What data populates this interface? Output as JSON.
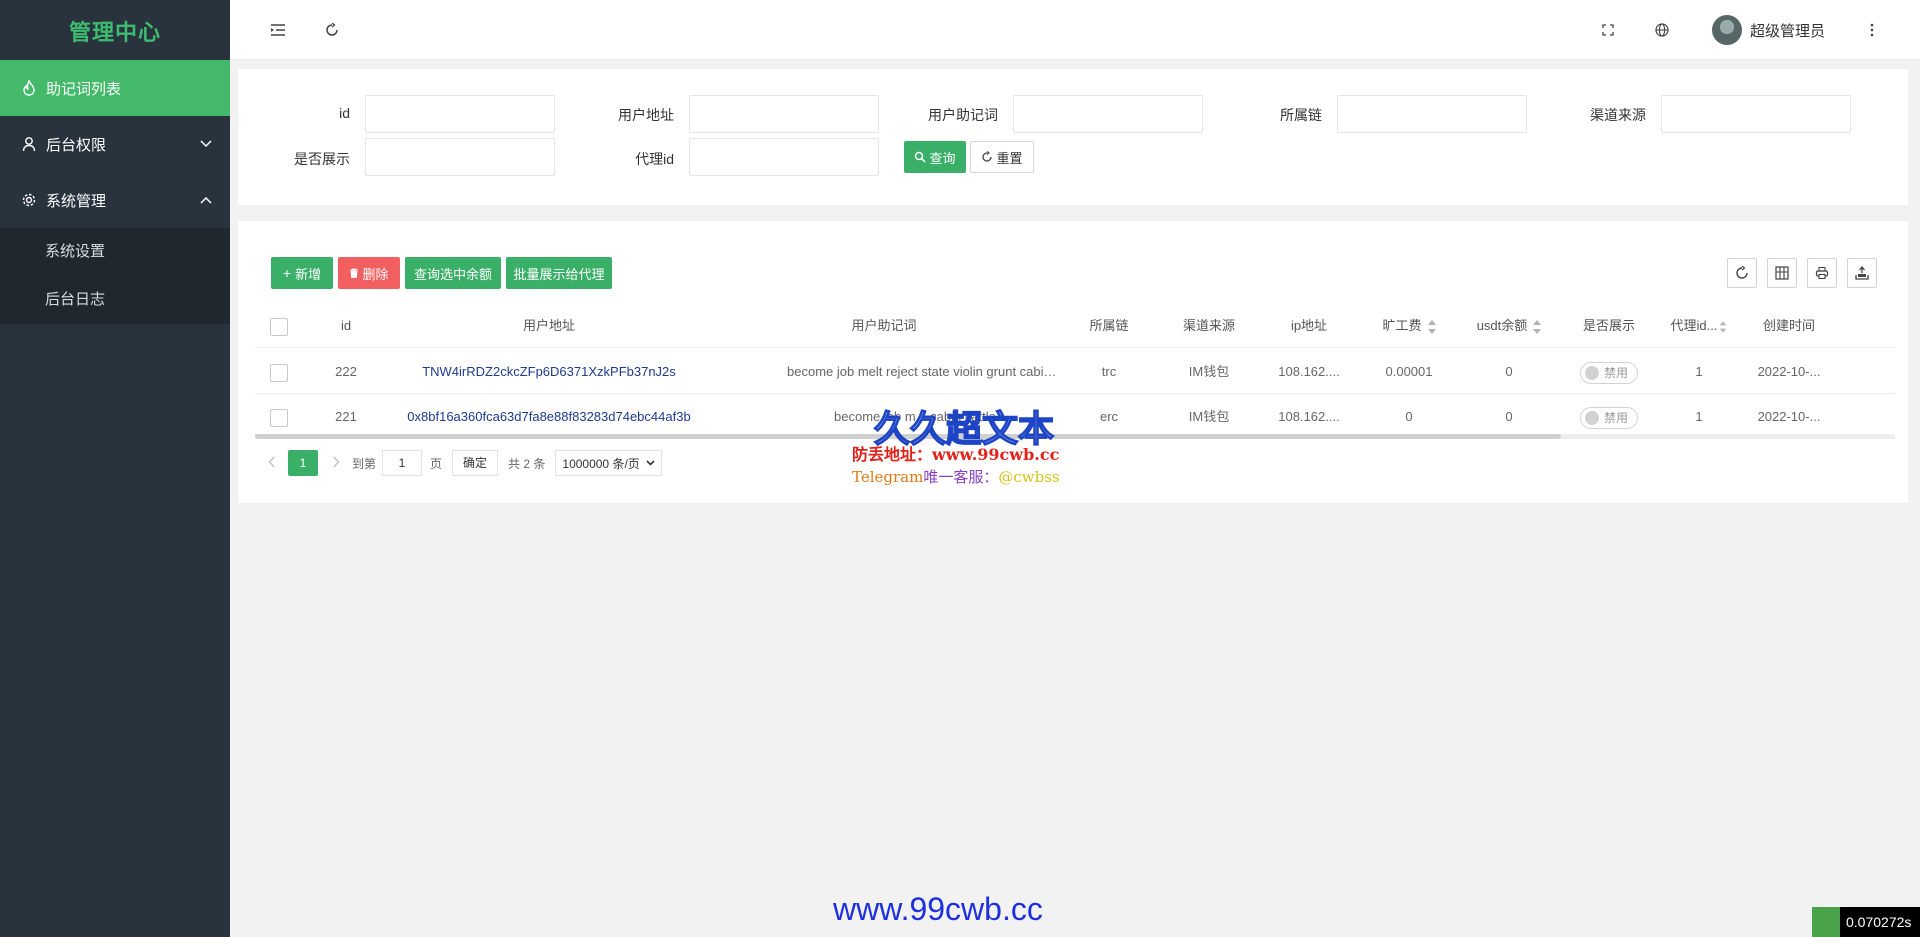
{
  "sidebar": {
    "logo": "管理中心",
    "items": [
      {
        "label": "助记词列表"
      },
      {
        "label": "后台权限"
      },
      {
        "label": "系统管理"
      }
    ],
    "sub_items": [
      {
        "label": "系统设置"
      },
      {
        "label": "后台日志"
      }
    ]
  },
  "header": {
    "username": "超级管理员"
  },
  "search": {
    "labels": {
      "id": "id",
      "address": "用户地址",
      "mnemonic": "用户助记词",
      "chain": "所属链",
      "channel": "渠道来源",
      "show": "是否展示",
      "agent": "代理id"
    },
    "query_label": "查询",
    "reset_label": "重置"
  },
  "toolbar": {
    "add_label": "新增",
    "delete_label": "删除",
    "balance_label": "查询选中余额",
    "batch_label": "批量展示给代理"
  },
  "table": {
    "columns": [
      "id",
      "用户地址",
      "用户助记词",
      "所属链",
      "渠道来源",
      "ip地址",
      "旷工费",
      "usdt余额",
      "是否展示",
      "代理id...",
      "创建时间"
    ],
    "rows": [
      {
        "id": "222",
        "address": "TNW4irRDZ2ckcZFp6D6371XzkPFb37nJ2s",
        "mnemonic": "become job melt reject state violin grunt cabin cattle r...",
        "chain": "trc",
        "channel": "IM钱包",
        "ip": "108.162....",
        "fee": "0.00001",
        "usdt": "0",
        "show": "禁用",
        "agent": "1",
        "created": "2022-10-..."
      },
      {
        "id": "221",
        "address": "0x8bf16a360fca63d7fa8e88f83283d74ebc44af3b",
        "mnemonic": "become job m... cabin cattle r...",
        "chain": "erc",
        "channel": "IM钱包",
        "ip": "108.162....",
        "fee": "0",
        "usdt": "0",
        "show": "禁用",
        "agent": "1",
        "created": "2022-10-..."
      }
    ]
  },
  "pager": {
    "current_page": "1",
    "goto_label": "到第",
    "goto_value": "1",
    "page_unit": "页",
    "confirm_label": "确定",
    "total_label": "共 2 条",
    "page_size": "1000000 条/页"
  },
  "watermark": {
    "title": "久久超文本",
    "line1": "防丢地址：www.99cwb.cc",
    "line2_prefix": "Telegram",
    "line2_mid": "唯一客服：",
    "line2_handle": "@cwbss",
    "footer_url": "www.99cwb.cc",
    "timer": "0.070272s"
  },
  "colors": {
    "accent_green": "#44b96a",
    "sidebar_bg": "#28333e",
    "danger_red": "#f15f61",
    "link_blue": "#1d3b8f"
  }
}
